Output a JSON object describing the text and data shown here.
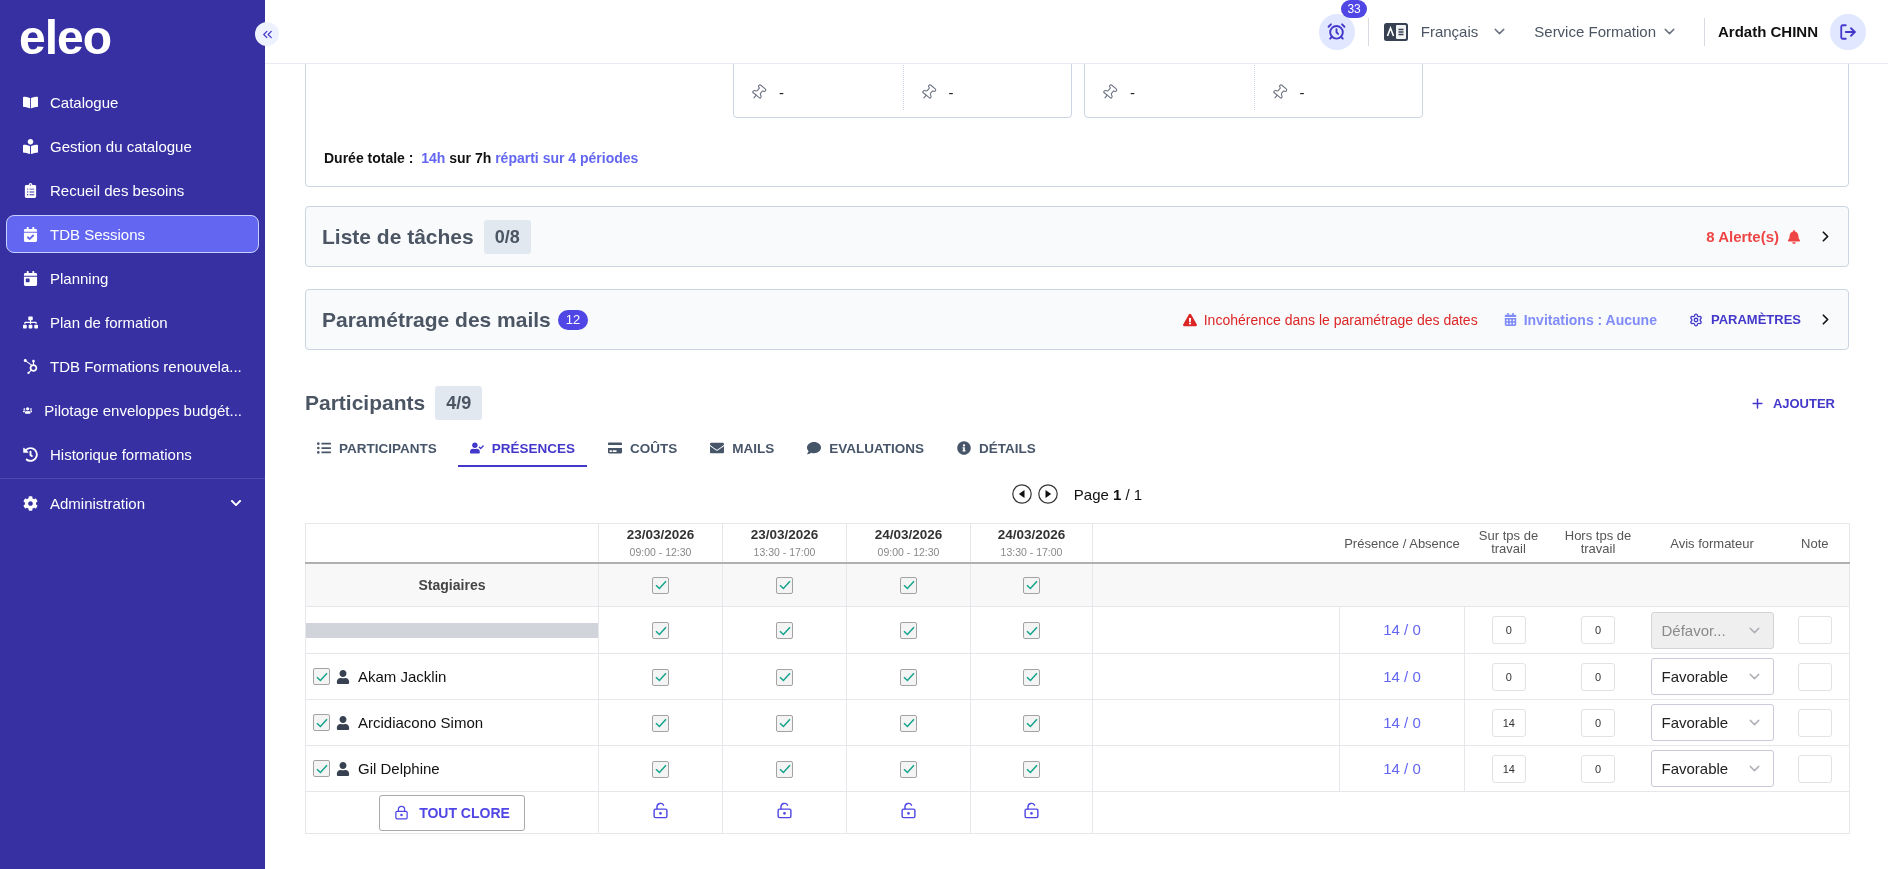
{
  "sidebar": {
    "logo": "eleo",
    "items": [
      {
        "label": "Catalogue",
        "kind": "link",
        "selected": false
      },
      {
        "label": "Gestion du catalogue",
        "kind": "link",
        "selected": false
      },
      {
        "label": "Recueil des besoins",
        "kind": "link",
        "selected": false
      },
      {
        "label": "TDB Sessions",
        "kind": "link",
        "selected": true
      },
      {
        "label": "Planning",
        "kind": "link",
        "selected": false
      },
      {
        "label": "Plan de formation",
        "kind": "link",
        "selected": false
      },
      {
        "label": "TDB Formations renouvela...",
        "kind": "link",
        "selected": false
      },
      {
        "label": "Pilotage enveloppes budgét...",
        "kind": "link",
        "selected": false
      },
      {
        "label": "Historique formations",
        "kind": "link",
        "selected": false
      },
      {
        "label": "Administration",
        "kind": "group",
        "selected": false,
        "expanded": false
      }
    ]
  },
  "header": {
    "notifications": "33",
    "language": "Français",
    "service": "Service Formation",
    "user": "Ardath CHINN"
  },
  "session_summary": {
    "period_cards": [
      {
        "slots": [
          {
            "location": "-"
          },
          {
            "location": "-"
          }
        ]
      },
      {
        "slots": [
          {
            "location": "-"
          },
          {
            "location": "-"
          }
        ]
      }
    ],
    "total_duration": {
      "label": "Durée totale :",
      "hours": "14h",
      "over": "sur 7h",
      "spread": "réparti sur 4 périodes"
    }
  },
  "task_list": {
    "title": "Liste de tâches",
    "count": "0/8",
    "alerts": "8 Alerte(s)"
  },
  "mail_settings": {
    "title": "Paramétrage des mails",
    "count": "12",
    "warning": "Incohérence dans le paramétrage des dates",
    "invitations": "Invitations : Aucune",
    "settings_button": "PARAMÈTRES"
  },
  "participants": {
    "title": "Participants",
    "count": "4/9",
    "add_button": "AJOUTER",
    "tabs": [
      {
        "label": "PARTICIPANTS",
        "selected": false
      },
      {
        "label": "PRÉSENCES",
        "selected": true
      },
      {
        "label": "COÛTS",
        "selected": false
      },
      {
        "label": "MAILS",
        "selected": false
      },
      {
        "label": "EVALUATIONS",
        "selected": false
      },
      {
        "label": "DÉTAILS",
        "selected": false
      }
    ],
    "pagination": "Page **1** / 1"
  },
  "attendance_table": {
    "columns": [
      {
        "date": "23/03/2026",
        "time": "09:00 - 12:30",
        "locked": false
      },
      {
        "date": "23/03/2026",
        "time": "13:30 - 17:00",
        "locked": false
      },
      {
        "date": "24/03/2026",
        "time": "09:00 - 12:30",
        "locked": false
      },
      {
        "date": "24/03/2026",
        "time": "13:30 - 17:00",
        "locked": false
      }
    ],
    "headers": {
      "presence": "Présence / Absence",
      "on_work_time": "Sur tps de travail",
      "off_work_time": "Hors tps de travail",
      "trainer_opinion": "Avis formateur",
      "note": "Note"
    },
    "group_row": {
      "label": "Stagiaires",
      "checks": [
        {
          "checked": true
        },
        {
          "checked": true
        },
        {
          "checked": true
        },
        {
          "checked": true
        }
      ]
    },
    "rows": [
      {
        "kind": "redacted",
        "checks": [
          {
            "checked": true
          },
          {
            "checked": true
          },
          {
            "checked": true
          },
          {
            "checked": true
          }
        ],
        "presence": "14 / 0",
        "on_work_time": "0",
        "off_work_time": "0",
        "opinion": {
          "value": "Défavor...",
          "disabled": true
        }
      },
      {
        "kind": "person",
        "checked": true,
        "name": "Akam Jacklin",
        "checks": [
          {
            "checked": true
          },
          {
            "checked": true
          },
          {
            "checked": true
          },
          {
            "checked": true
          }
        ],
        "presence": "14 / 0",
        "on_work_time": "0",
        "off_work_time": "0",
        "opinion": {
          "value": "Favorable",
          "disabled": false
        }
      },
      {
        "kind": "person",
        "checked": true,
        "name": "Arcidiacono Simon",
        "checks": [
          {
            "checked": true
          },
          {
            "checked": true
          },
          {
            "checked": true
          },
          {
            "checked": true
          }
        ],
        "presence": "14 / 0",
        "on_work_time": "14",
        "off_work_time": "0",
        "opinion": {
          "value": "Favorable",
          "disabled": false
        }
      },
      {
        "kind": "person",
        "checked": true,
        "name": "Gil Delphine",
        "checks": [
          {
            "checked": true
          },
          {
            "checked": true
          },
          {
            "checked": true
          },
          {
            "checked": true
          }
        ],
        "presence": "14 / 0",
        "on_work_time": "14",
        "off_work_time": "0",
        "opinion": {
          "value": "Favorable",
          "disabled": false
        }
      }
    ],
    "footer": {
      "close_all": "TOUT CLORE"
    }
  }
}
